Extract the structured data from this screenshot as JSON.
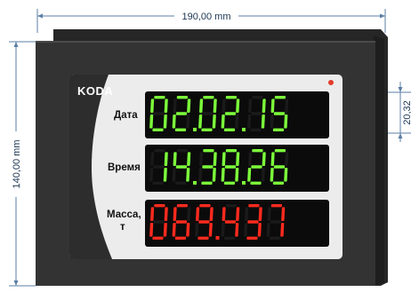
{
  "dimensions": {
    "width_label": "190,00 mm",
    "height_label": "140,00 mm",
    "row_height_label": "20,32"
  },
  "brand": {
    "logo_text": "KODA"
  },
  "rows": [
    {
      "label_lines": [
        "Дата"
      ],
      "value": "02.02.15",
      "color": "#7CFF3A"
    },
    {
      "label_lines": [
        "Время"
      ],
      "value": "14.38.26",
      "color": "#7CFF3A"
    },
    {
      "label_lines": [
        "Масса,",
        "т"
      ],
      "value": "069.437",
      "color": "#FF2A1E"
    }
  ],
  "colors": {
    "housing": "#2f2f30",
    "faceplate": "#ececec",
    "led_bg": "#0b0b0b",
    "indicator_dot": "#e23b2b",
    "dimension_line": "#5b7fa6"
  }
}
